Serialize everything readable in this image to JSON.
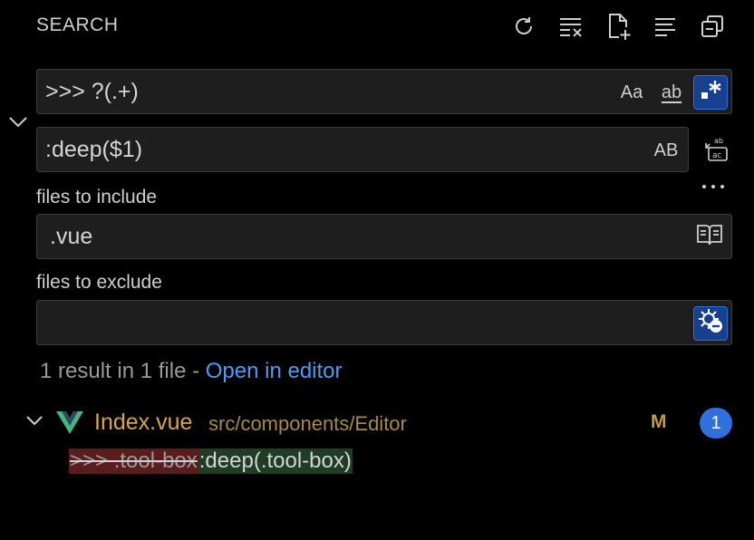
{
  "panel": {
    "title": "SEARCH",
    "toolbar": [
      {
        "name": "refresh-icon",
        "label": "Refresh"
      },
      {
        "name": "clear-results-icon",
        "label": "Clear Search Results"
      },
      {
        "name": "new-search-editor-icon",
        "label": "Open New Search Editor"
      },
      {
        "name": "view-as-tree-icon",
        "label": "View as Tree"
      },
      {
        "name": "collapse-all-icon",
        "label": "Collapse All"
      }
    ]
  },
  "search": {
    "value": ">>> ?(.+)",
    "match_case_label": "Aa",
    "whole_word_label": "ab",
    "regex_enabled": true
  },
  "replace": {
    "value": ":deep($1)",
    "preserve_case_label": "AB"
  },
  "include": {
    "label": "files to include",
    "value": ".vue"
  },
  "exclude": {
    "label": "files to exclude",
    "value": ""
  },
  "results": {
    "summary": "1 result in 1 file - ",
    "open_in_editor": "Open in editor",
    "files": [
      {
        "name": "Index.vue",
        "path": "src/components/Editor",
        "status": "M",
        "count": "1",
        "matches": [
          {
            "removed": ">>> .tool-box",
            "added": ":deep(.tool-box)"
          }
        ]
      }
    ]
  },
  "colors": {
    "accent": "#2f6fde",
    "link": "#4d9cf4",
    "file_name": "#d7a54a",
    "removed_bg": "#5a1d1d",
    "added_bg": "#1f3d26"
  }
}
